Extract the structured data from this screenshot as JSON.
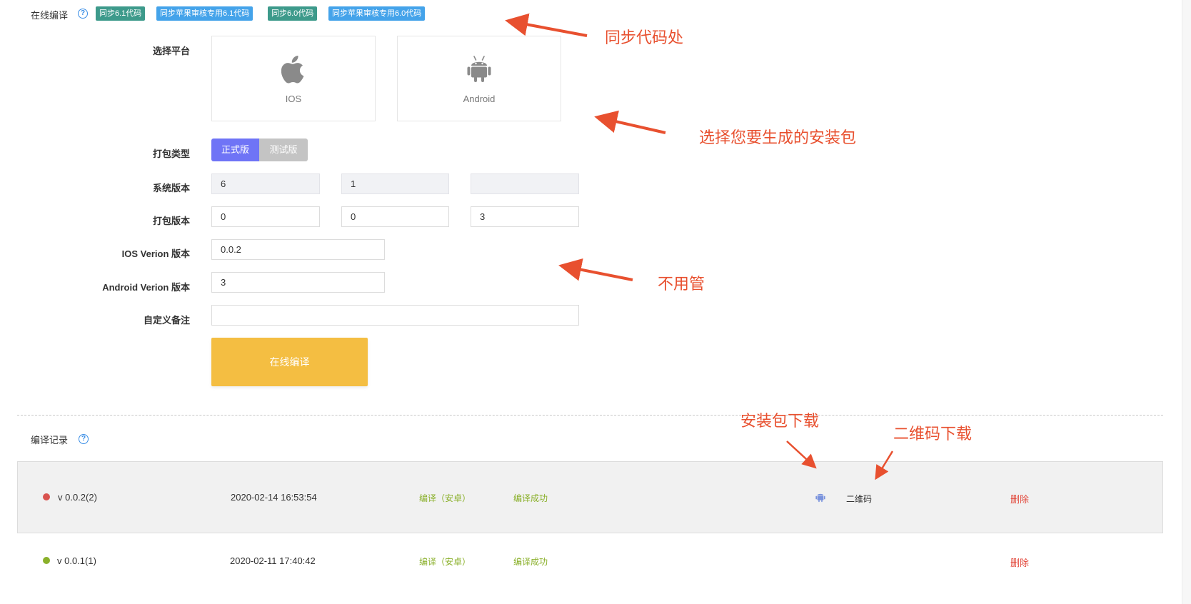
{
  "online_compile": {
    "title": "在线编译",
    "sync_tags": [
      {
        "label": "同步6.1代码",
        "color": "#3d9a8b"
      },
      {
        "label": "同步苹果审核专用6.1代码",
        "color": "#44a3ea"
      },
      {
        "label": "同步6.0代码",
        "color": "#3d9a8b"
      },
      {
        "label": "同步苹果审核专用6.0代码",
        "color": "#44a3ea"
      }
    ]
  },
  "form": {
    "platform_label": "选择平台",
    "platforms": [
      {
        "name": "IOS",
        "icon": "apple-icon"
      },
      {
        "name": "Android",
        "icon": "android-icon"
      }
    ],
    "pack_type_label": "打包类型",
    "pack_types": [
      "正式版",
      "测试版"
    ],
    "system_version_label": "系统版本",
    "system_version": [
      "6",
      "1",
      ""
    ],
    "pack_version_label": "打包版本",
    "pack_version": [
      "0",
      "0",
      "3"
    ],
    "ios_version_label": "IOS Verion 版本",
    "ios_version": "0.0.2",
    "android_version_label": "Android Verion 版本",
    "android_version": "3",
    "remark_label": "自定义备注",
    "remark": "",
    "compile_button": "在线编译"
  },
  "records": {
    "title": "编译记录",
    "rows": [
      {
        "status_color": "#d9534f",
        "version": "v 0.0.2(2)",
        "time": "2020-02-14 16:53:54",
        "action": "编译（安卓）",
        "result": "编译成功",
        "has_download": true,
        "qr": "二维码",
        "delete": "删除"
      },
      {
        "status_color": "#8ab02a",
        "version": "v 0.0.1(1)",
        "time": "2020-02-11 17:40:42",
        "action": "编译（安卓）",
        "result": "编译成功",
        "has_download": false,
        "qr": "",
        "delete": "删除"
      }
    ]
  },
  "annotations": {
    "sync": "同步代码处",
    "choose": "选择您要生成的安装包",
    "ignore": "不用管",
    "download": "安装包下载",
    "qr": "二维码下载",
    "color": "#e8502f"
  }
}
